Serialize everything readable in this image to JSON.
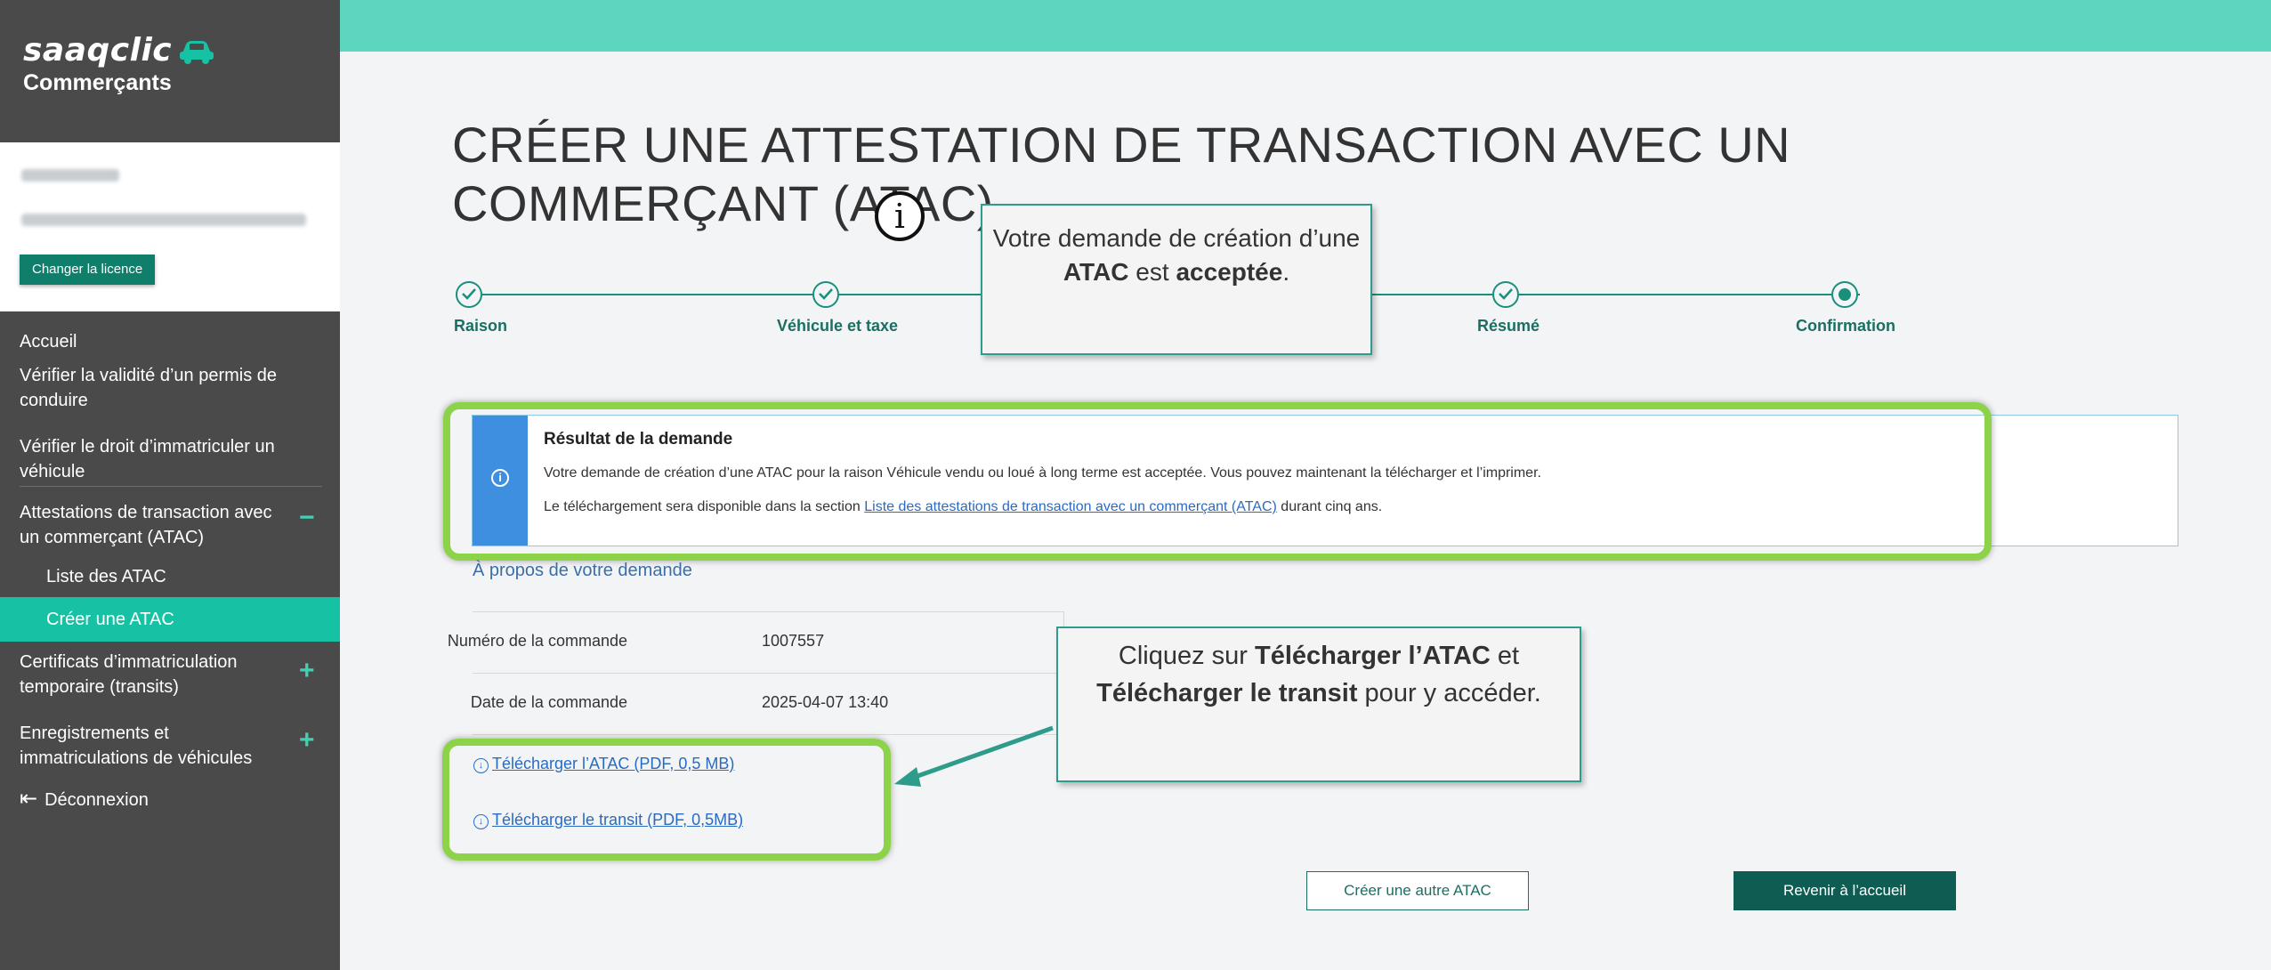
{
  "brand": {
    "name": "saaqclic",
    "subtitle": "Commerçants"
  },
  "license": {
    "change_label": "Changer la licence"
  },
  "sidebar": {
    "items": [
      {
        "label": "Accueil"
      },
      {
        "label": "Vérifier la validité d’un permis de conduire"
      },
      {
        "label": "Vérifier le droit d’immatriculer un véhicule"
      },
      {
        "label": "Attestations de transaction avec un commerçant (ATAC)",
        "toggle": "−"
      },
      {
        "label": "Liste des ATAC"
      },
      {
        "label": "Créer une ATAC",
        "active": true
      },
      {
        "label": "Certificats d’immatriculation temporaire (transits)",
        "toggle": "+"
      },
      {
        "label": "Enregistrements et immatriculations de véhicules",
        "toggle": "+"
      },
      {
        "label": "Déconnexion"
      }
    ]
  },
  "page": {
    "title": "CRÉER UNE ATTESTATION DE TRANSACTION AVEC UN COMMERÇANT (ATAC)"
  },
  "stepper": {
    "steps": [
      {
        "label": "Raison",
        "state": "done"
      },
      {
        "label": "Véhicule et taxe",
        "state": "done"
      },
      {
        "label": "Résumé",
        "state": "done"
      },
      {
        "label": "Confirmation",
        "state": "current"
      }
    ]
  },
  "callouts": {
    "accepted": {
      "part1": "Votre demande de création d’une ",
      "bold1": "ATAC",
      "part2": " est ",
      "bold2": "acceptée",
      "part3": "."
    },
    "download": {
      "part1": "Cliquez sur ",
      "bold1": "Télécharger l’ATAC",
      "part2": " et ",
      "bold2": "Télécharger le transit",
      "part3": " pour y accéder."
    }
  },
  "result": {
    "title": "Résultat de la demande",
    "line1": "Votre demande de création d’une ATAC pour la raison Véhicule vendu ou loué à long terme est acceptée. Vous pouvez maintenant la télécharger et l’imprimer.",
    "line2_before": "Le téléchargement sera disponible dans la section ",
    "line2_link": "Liste des attestations de transaction avec un commerçant (ATAC)",
    "line2_after": " durant cinq ans."
  },
  "about": {
    "title": "À propos de votre demande",
    "rows": [
      {
        "label": "Numéro de la commande",
        "value": "1007557"
      },
      {
        "label": "Date de la commande",
        "value": "2025-04-07 13:40"
      }
    ]
  },
  "downloads": {
    "atac": "Télécharger l’ATAC (PDF, 0,5 MB)",
    "transit": "Télécharger le transit (PDF, 0,5MB)"
  },
  "buttons": {
    "create_another": "Créer une autre ATAC",
    "back_home": "Revenir à l’accueil"
  },
  "colors": {
    "topbar": "#5cd6be",
    "sidebar": "#4a4a4a",
    "active_nav": "#17c2a4",
    "highlight": "#8cd34a",
    "info_bar": "#3f8fe0",
    "primary_button": "#0f5c52"
  }
}
